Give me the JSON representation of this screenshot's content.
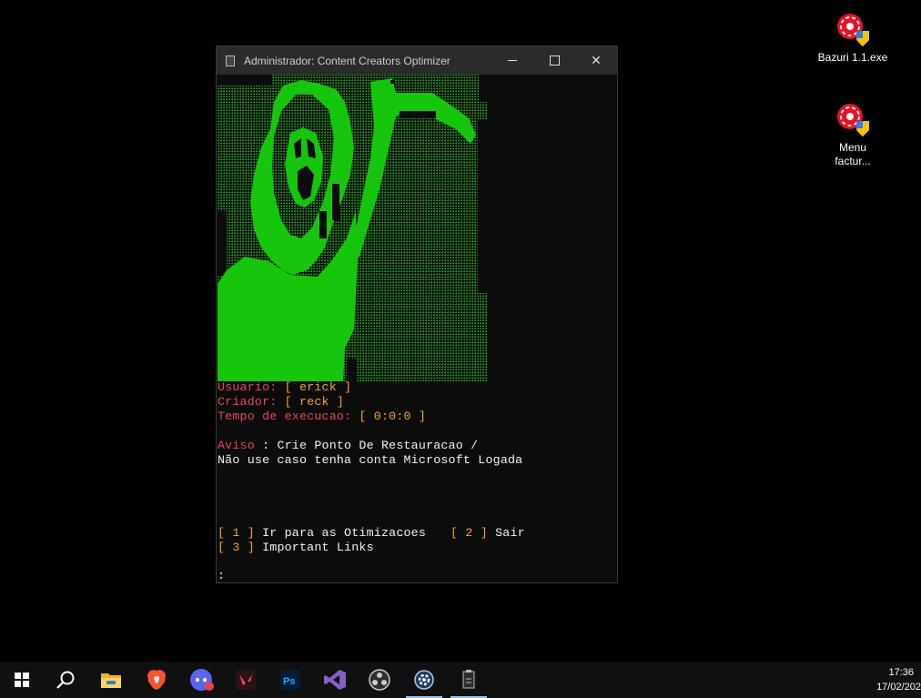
{
  "desktop": {
    "icons": [
      {
        "label": "Bazuri 1.1.exe",
        "icon": "setup-shield-icon"
      },
      {
        "label": "Menu factur...",
        "icon": "setup-shield-icon"
      }
    ]
  },
  "window": {
    "title": "Administrador:  Content Creators Optimizer",
    "controls": {
      "minimize": "minimize-icon",
      "maximize": "maximize-icon",
      "close": "✕"
    }
  },
  "console": {
    "art_color": "#16c60c",
    "usuario_label": "Usuario: ",
    "usuario_value": "[ erick ]",
    "criador_label": "Criador: ",
    "criador_value": "[ reck ]",
    "tempo_label": "Tempo de execucao: ",
    "tempo_value": "[ 0:0:0 ]",
    "aviso_label": "Aviso",
    "aviso_text": " : Crie Ponto De Restauracao /",
    "aviso_line2": "Não use caso tenha conta Microsoft Logada",
    "menu": [
      {
        "key": "[ 1 ]",
        "label": " Ir para as Otimizacoes"
      },
      {
        "key": "[ 2 ]",
        "label": " Sair"
      },
      {
        "key": "[ 3 ]",
        "label": " Important Links"
      }
    ],
    "prompt": ":"
  },
  "taskbar": {
    "apps": [
      "windows-start-icon",
      "search-icon",
      "file-explorer-icon",
      "brave-browser-icon",
      "discord-icon",
      "valorant-icon",
      "photoshop-icon",
      "visual-studio-icon",
      "obs-studio-icon",
      "settings-gear-icon",
      "console-icon"
    ],
    "time": "17:36",
    "date": "17/02/202"
  },
  "colors": {
    "terminal_red": "#e74856",
    "terminal_orange": "#f7a034",
    "art_green": "#16c60c"
  }
}
